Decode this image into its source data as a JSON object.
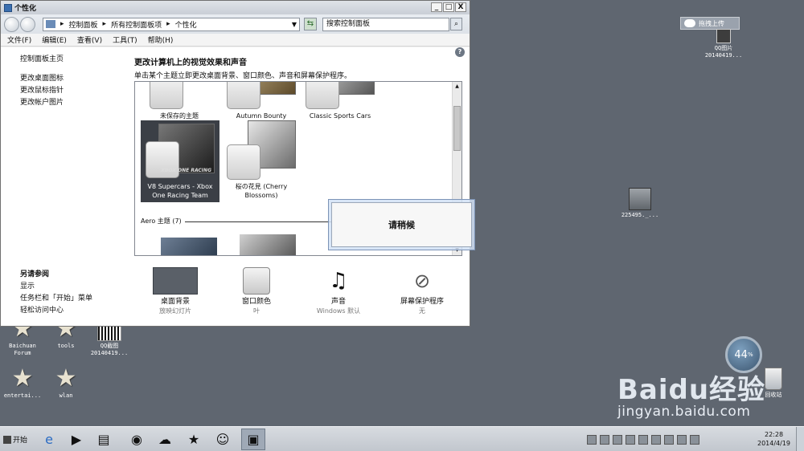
{
  "window": {
    "title": "个性化",
    "controls": {
      "minimize": "_",
      "maximize": "□",
      "close": "X"
    }
  },
  "address": {
    "crumbs": [
      "控制面板",
      "所有控制面板项",
      "个性化"
    ],
    "separator": "▸",
    "search_placeholder": "搜索控制面板"
  },
  "menu": [
    "文件(F)",
    "编辑(E)",
    "查看(V)",
    "工具(T)",
    "帮助(H)"
  ],
  "leftnav": {
    "home": "控制面板主页",
    "links": [
      "更改桌面图标",
      "更改鼠标指针",
      "更改帐户图片"
    ],
    "seealso_title": "另请参阅",
    "seealso": [
      "显示",
      "任务栏和「开始」菜单",
      "轻松访问中心"
    ]
  },
  "main": {
    "heading": "更改计算机上的视觉效果和声音",
    "subheading": "单击某个主题立即更改桌面背景、窗口颜色、声音和屏幕保护程序。",
    "themes": [
      {
        "name": "未保存的主题",
        "selected": false
      },
      {
        "name": "Autumn Bounty",
        "selected": false
      },
      {
        "name": "Classic Sports Cars",
        "selected": false
      },
      {
        "name": "V8 Supercars - Xbox One Racing Team",
        "selected": true,
        "badge": "XBOX ONE RACING"
      },
      {
        "name": "桜の花見 (Cherry Blossoms)",
        "selected": false
      }
    ],
    "aero_label": "Aero 主题 (7)"
  },
  "bottom": [
    {
      "label": "桌面背景",
      "sub": "放映幻灯片",
      "icon": "desktop-background-icon"
    },
    {
      "label": "窗口颜色",
      "sub": "叶",
      "icon": "window-color-icon"
    },
    {
      "label": "声音",
      "sub": "Windows 默认",
      "icon": "sound-icon"
    },
    {
      "label": "屏幕保护程序",
      "sub": "无",
      "icon": "screensaver-icon"
    }
  ],
  "wait_dialog": {
    "text": "请稍候"
  },
  "desktop": {
    "icons": [
      {
        "label": "Baichuan\nForum",
        "icon": "star-icon"
      },
      {
        "label": "tools",
        "icon": "star-icon"
      },
      {
        "label": "QQ截图\n20140419...",
        "icon": "barcode-image-icon"
      },
      {
        "label": "entertai...",
        "icon": "star-icon"
      },
      {
        "label": "wlan",
        "icon": "star-icon"
      },
      {
        "label": "QQ图片\n20140419...",
        "icon": "photo-icon"
      },
      {
        "label": "225495._...",
        "icon": "archive-icon"
      },
      {
        "label": "回收站",
        "icon": "recycle-bin-icon"
      }
    ],
    "upload_button": "拖拽上传",
    "gauge_value": "44",
    "gauge_unit": "%",
    "watermark_big": "Baidu经验",
    "watermark_url": "jingyan.baidu.com"
  },
  "taskbar": {
    "start_label": "开始",
    "time": "22:28",
    "date": "2014/4/19"
  }
}
